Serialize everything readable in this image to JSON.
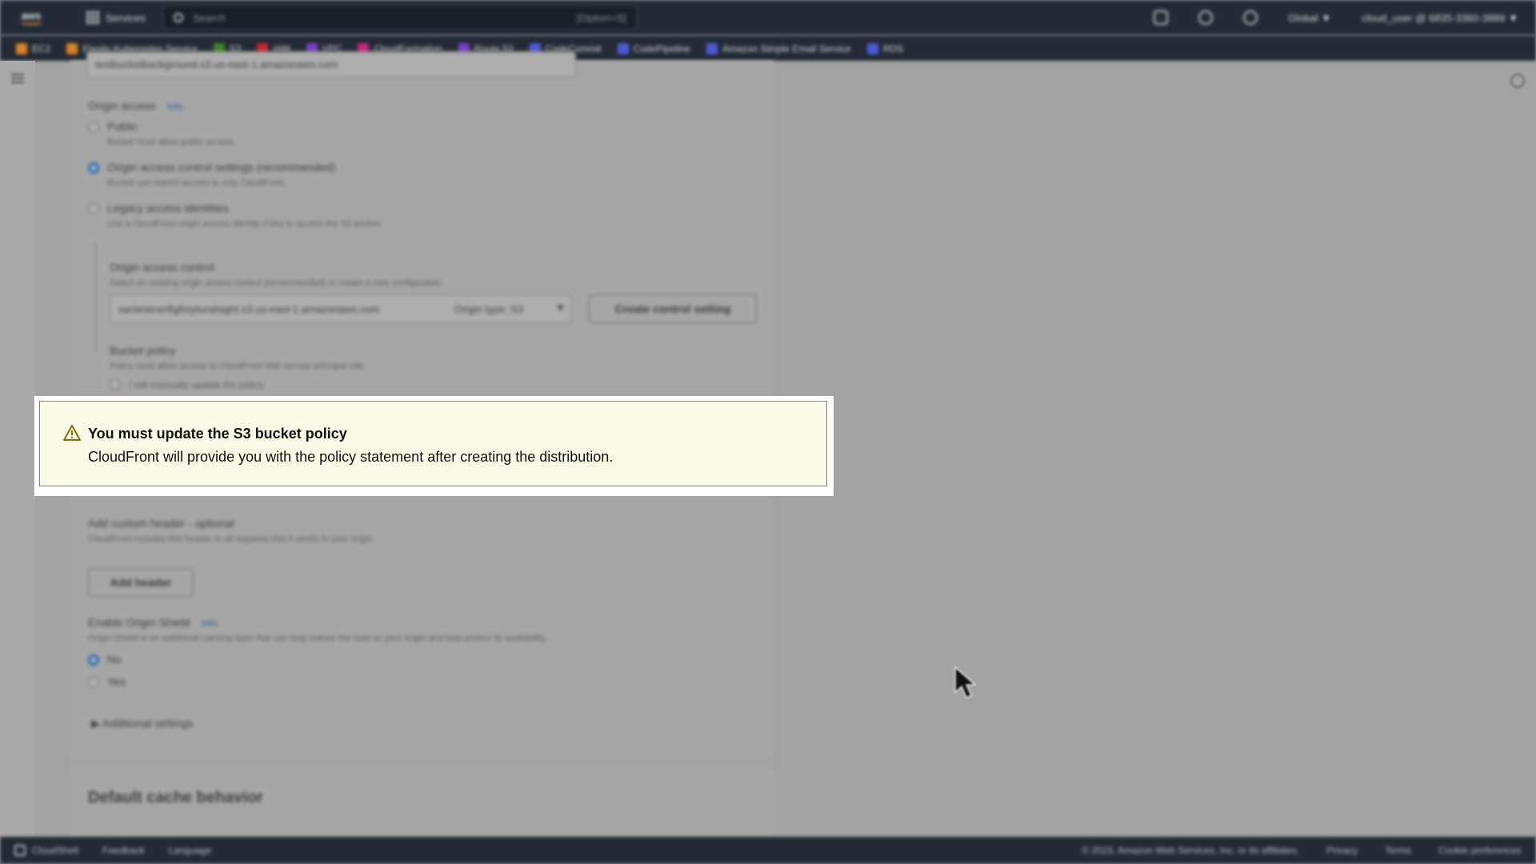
{
  "nav": {
    "logo": "aws",
    "services_label": "Services",
    "search_placeholder": "Search",
    "search_shortcut": "[Option+S]",
    "region": "Global ▼",
    "account": "cloud_user @ 6835-3360-3889 ▼"
  },
  "favorites": [
    {
      "label": "EC2",
      "color": "#d9822b"
    },
    {
      "label": "Elastic Kubernetes Service",
      "color": "#d9822b"
    },
    {
      "label": "S3",
      "color": "#3f8624"
    },
    {
      "label": "IAM",
      "color": "#c7242f"
    },
    {
      "label": "VPC",
      "color": "#7a3fc6"
    },
    {
      "label": "CloudFormation",
      "color": "#c8257b"
    },
    {
      "label": "Route 53",
      "color": "#7a3fc6"
    },
    {
      "label": "CodeCommit",
      "color": "#4b5bd6"
    },
    {
      "label": "CodePipeline",
      "color": "#4b5bd6"
    },
    {
      "label": "Amazon Simple Email Service",
      "color": "#4b5bd6"
    },
    {
      "label": "RDS",
      "color": "#4b5bd6"
    }
  ],
  "form": {
    "origin_domain_value": "testbucketbackground.s3.us-east-1.amazonaws.com",
    "origin_access_label": "Origin access",
    "info": "Info",
    "public_label": "Public",
    "public_desc": "Bucket must allow public access.",
    "oac_label": "Origin access control settings (recommended)",
    "oac_desc": "Bucket can restrict access to only CloudFront.",
    "legacy_label": "Legacy access identities",
    "legacy_desc": "Use a CloudFront origin access identity (OAI) to access the S3 bucket.",
    "oac_field_label": "Origin access control",
    "oac_field_desc": "Select an existing origin access control (recommended) or create a new configuration.",
    "oac_select_value": "sactestconfigforpluralsight.s3.us-east-1.amazonaws.com",
    "origin_type": "Origin type: S3",
    "create_button": "Create control setting",
    "bucket_policy_label": "Bucket policy",
    "bucket_policy_desc": "Policy must allow access to CloudFront IAM service principal role.",
    "manual_update_label": "I will manually update the policy",
    "custom_header_label": "Add custom header - optional",
    "custom_header_desc": "CloudFront includes this header in all requests that it sends to your origin.",
    "add_header_button": "Add header",
    "origin_shield_label": "Enable Origin Shield",
    "origin_shield_desc": "Origin Shield is an additional caching layer that can help reduce the load on your origin and help protect its availability.",
    "no_label": "No",
    "yes_label": "Yes",
    "additional_settings": "Additional settings",
    "default_cache_heading": "Default cache behavior"
  },
  "alert": {
    "title": "You must update the S3 bucket policy",
    "body": "CloudFront will provide you with the policy statement after creating the distribution.",
    "accent_color": "#8a6d00"
  },
  "footer": {
    "cloudshell": "CloudShell",
    "feedback": "Feedback",
    "language": "Language",
    "copyright": "© 2023, Amazon Web Services, Inc. or its affiliates.",
    "privacy": "Privacy",
    "terms": "Terms",
    "cookies": "Cookie preferences"
  }
}
